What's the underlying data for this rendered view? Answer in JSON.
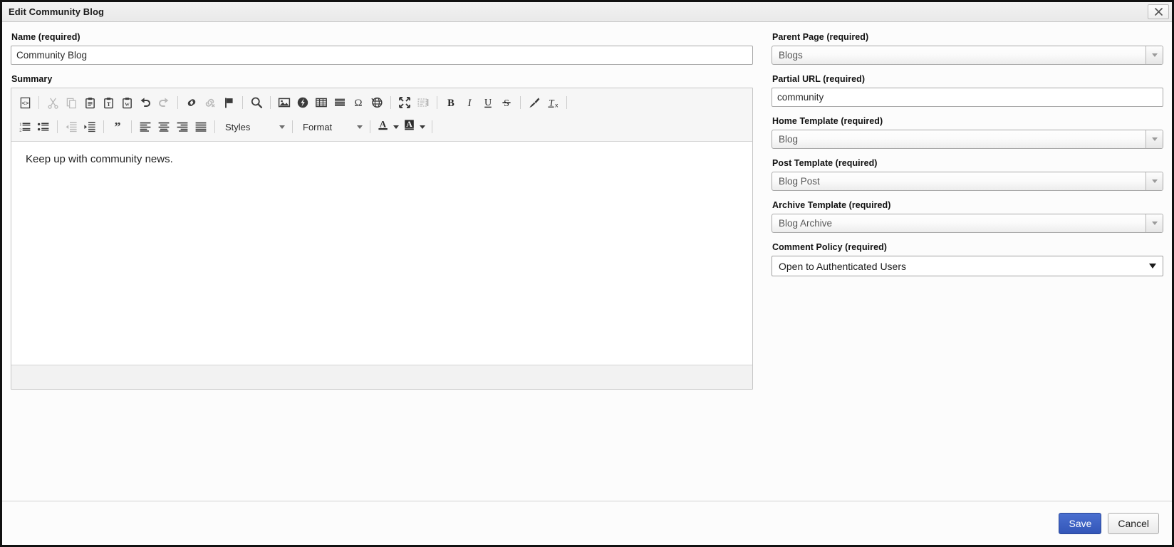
{
  "window": {
    "title": "Edit Community Blog",
    "close_label": "×",
    "close_icon": "close-icon"
  },
  "left": {
    "name_label": "Name (required)",
    "name_value": "Community Blog",
    "name_placeholder": "",
    "summary_label": "Summary",
    "editor": {
      "content": "Keep up with community news.",
      "styles_label": "Styles",
      "format_label": "Format",
      "toolbar_row1": [
        {
          "icon": "source-code-icon",
          "title": "Source",
          "disabled": false
        },
        {
          "sep": true
        },
        {
          "icon": "cut-icon",
          "title": "Cut",
          "disabled": true
        },
        {
          "icon": "copy-icon",
          "title": "Copy",
          "disabled": true
        },
        {
          "icon": "paste-icon",
          "title": "Paste",
          "disabled": false
        },
        {
          "icon": "paste-as-text-icon",
          "title": "Paste as plain text",
          "disabled": false
        },
        {
          "icon": "paste-from-word-icon",
          "title": "Paste from Word",
          "disabled": false
        },
        {
          "icon": "undo-icon",
          "title": "Undo",
          "disabled": false
        },
        {
          "icon": "redo-icon",
          "title": "Redo",
          "disabled": true
        },
        {
          "sep": true
        },
        {
          "icon": "link-icon",
          "title": "Link",
          "disabled": false
        },
        {
          "icon": "unlink-icon",
          "title": "Unlink",
          "disabled": true
        },
        {
          "icon": "anchor-flag-icon",
          "title": "Anchor",
          "disabled": false
        },
        {
          "sep": true
        },
        {
          "icon": "find-icon",
          "title": "Find",
          "disabled": false
        },
        {
          "sep": true
        },
        {
          "icon": "image-icon",
          "title": "Image",
          "disabled": false
        },
        {
          "icon": "flash-media-icon",
          "title": "Flash",
          "disabled": false
        },
        {
          "icon": "table-icon",
          "title": "Table",
          "disabled": false
        },
        {
          "icon": "horizontal-rule-icon",
          "title": "Horizontal Line",
          "disabled": false
        },
        {
          "icon": "special-character-icon",
          "title": "Insert Special Character",
          "disabled": false
        },
        {
          "icon": "iframe-globe-icon",
          "title": "IFrame",
          "disabled": false
        },
        {
          "sep": true
        },
        {
          "icon": "maximize-icon",
          "title": "Maximize",
          "disabled": false
        },
        {
          "icon": "show-blocks-icon",
          "title": "Show Blocks",
          "disabled": true
        },
        {
          "sep": true
        },
        {
          "icon": "bold-icon",
          "title": "Bold",
          "disabled": false
        },
        {
          "icon": "italic-icon",
          "title": "Italic",
          "disabled": false
        },
        {
          "icon": "underline-icon",
          "title": "Underline",
          "disabled": false
        },
        {
          "icon": "strikethrough-icon",
          "title": "Strikethrough",
          "disabled": false
        },
        {
          "sep": true
        },
        {
          "icon": "remove-format-brush-icon",
          "title": "Remove Format",
          "disabled": false
        },
        {
          "icon": "clear-text-format-icon",
          "title": "Remove Text Format",
          "disabled": false
        },
        {
          "sep": true
        }
      ],
      "toolbar_row2": [
        {
          "icon": "numbered-list-icon",
          "title": "Insert/Remove Numbered List",
          "disabled": false
        },
        {
          "icon": "bulleted-list-icon",
          "title": "Insert/Remove Bulleted List",
          "disabled": false
        },
        {
          "sep": true
        },
        {
          "icon": "decrease-indent-icon",
          "title": "Decrease Indent",
          "disabled": true
        },
        {
          "icon": "increase-indent-icon",
          "title": "Increase Indent",
          "disabled": false
        },
        {
          "sep": true
        },
        {
          "icon": "blockquote-icon",
          "title": "Block Quote",
          "disabled": false
        },
        {
          "sep": true
        },
        {
          "icon": "align-left-icon",
          "title": "Align Left",
          "disabled": false
        },
        {
          "icon": "align-center-icon",
          "title": "Center",
          "disabled": false
        },
        {
          "icon": "align-right-icon",
          "title": "Align Right",
          "disabled": false
        },
        {
          "icon": "justify-icon",
          "title": "Justify",
          "disabled": false
        },
        {
          "sep": true
        }
      ]
    }
  },
  "right": {
    "fields": [
      {
        "label": "Parent Page (required)",
        "value": "Blogs",
        "control": "custom-select",
        "name": "parent-page"
      },
      {
        "label": "Partial URL (required)",
        "value": "community",
        "control": "text",
        "name": "partial-url"
      },
      {
        "label": "Home Template (required)",
        "value": "Blog",
        "control": "custom-select",
        "name": "home-template"
      },
      {
        "label": "Post Template (required)",
        "value": "Blog Post",
        "control": "custom-select",
        "name": "post-template"
      },
      {
        "label": "Archive Template (required)",
        "value": "Blog Archive",
        "control": "custom-select",
        "name": "archive-template"
      },
      {
        "label": "Comment Policy (required)",
        "value": "Open to Authenticated Users",
        "control": "native-select",
        "name": "comment-policy"
      }
    ]
  },
  "footer": {
    "save_label": "Save",
    "cancel_label": "Cancel"
  },
  "colors": {
    "primary": "#3356b8",
    "titlebar": "#efefef",
    "background": "#fcfcfc",
    "toolbar": "#f6f6f6",
    "border": "#c7c7c7"
  }
}
